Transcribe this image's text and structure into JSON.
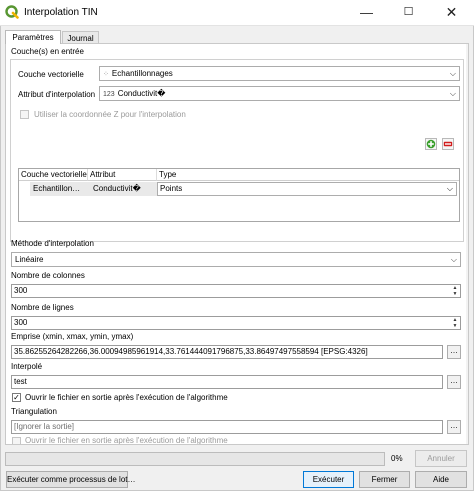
{
  "window": {
    "title": "Interpolation TIN"
  },
  "tabs": [
    {
      "label": "Paramètres"
    },
    {
      "label": "Journal"
    }
  ],
  "input_layers": {
    "section_label": "Couche(s) en entrée",
    "vector_layer_label": "Couche vectorielle",
    "vector_layer_value": "Echantillonnages",
    "attribute_label": "Attribut d'interpolation",
    "attribute_type_prefix": "123",
    "attribute_value": "Conductivit�",
    "use_z_label": "Utiliser la coordonnée Z pour l'interpolation",
    "use_z_checked": false,
    "table": {
      "headers": [
        "Couche vectorielle",
        "Attribut",
        "Type"
      ],
      "rows": [
        {
          "layer": "Echantillon…",
          "attribute": "Conductivit�",
          "type": "Points"
        }
      ]
    }
  },
  "method": {
    "label": "Méthode d'interpolation",
    "value": "Linéaire"
  },
  "columns": {
    "label": "Nombre de colonnes",
    "value": "300"
  },
  "rows": {
    "label": "Nombre de lignes",
    "value": "300"
  },
  "extent": {
    "label": "Emprise (xmin, xmax, ymin, ymax)",
    "value": "35.86255264282266,36.00094985961914,33.761444091796875,33.86497497558594 [EPSG:4326]"
  },
  "interpolated": {
    "label": "Interpolé",
    "value": "test",
    "open_after_label": "Ouvrir le fichier en sortie après l'exécution de l'algorithme",
    "open_after_checked": true
  },
  "triangulation": {
    "label": "Triangulation",
    "placeholder": "[Ignorer la sortie]",
    "open_after_label": "Ouvrir le fichier en sortie après l'exécution de l'algorithme",
    "open_after_checked": false
  },
  "progress": {
    "percent_text": "0%",
    "fraction": 0
  },
  "buttons": {
    "cancel": "Annuler",
    "batch": "Exécuter comme processus de lot…",
    "run": "Exécuter",
    "close": "Fermer",
    "help": "Aide"
  },
  "glyphs": {
    "check": "✓",
    "arrow_down": "⌵",
    "dots": "…",
    "spin_up": "▲",
    "spin_down": "▼"
  },
  "colors": {
    "qgis_green": "#589632",
    "add_green": "#3a9f2d",
    "remove_red": "#d11e1e",
    "row_selected": "#e9e9e9",
    "primary_border": "#0078d7"
  }
}
